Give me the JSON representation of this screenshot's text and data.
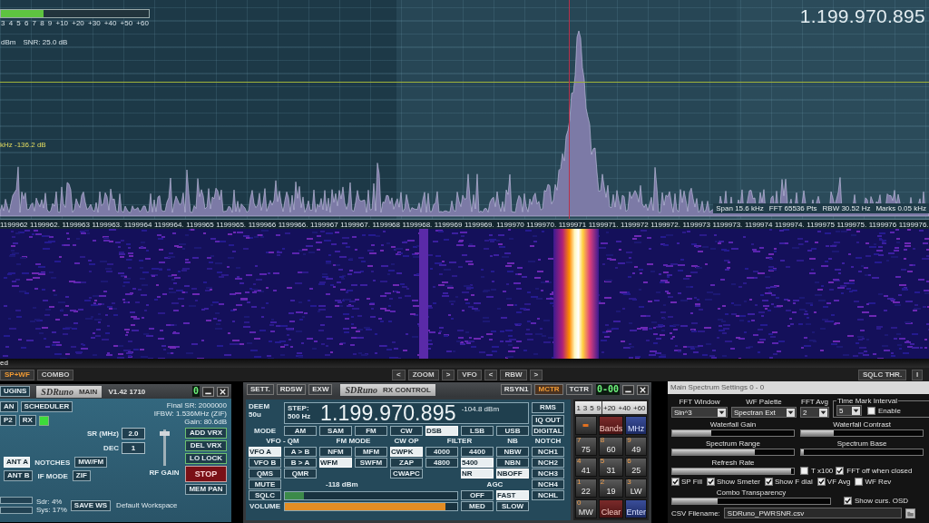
{
  "spectrum": {
    "smeter": {
      "level": 0.29,
      "scale": [
        "3",
        "4",
        "5",
        "6",
        "7",
        "8",
        "9",
        "+10",
        "+20",
        "+30",
        "+40",
        "+50",
        "+60"
      ]
    },
    "readouts": [
      "dBm",
      "SNR: 25.0 dB"
    ],
    "marker_readout": "kHz -136.2 dB",
    "frequency": "1.199.970.895",
    "info": [
      "Span 15.6 kHz",
      "FFT 65536 Pts",
      "RBW 30.52 Hz",
      "Marks 0.05 kHz"
    ],
    "axis_labels": [
      "1199962",
      "1199962.",
      "1199963",
      "1199963.",
      "1199964",
      "1199964.",
      "1199965",
      "1199965.",
      "1199966",
      "1199966.",
      "1199967",
      "1199967.",
      "1199968",
      "1199968.",
      "1199969",
      "1199969.",
      "1199970",
      "1199970.",
      "1199971",
      "1199971.",
      "1199972",
      "1199972.",
      "1199973",
      "1199973.",
      "1199974",
      "1199974.",
      "1199975",
      "1199975.",
      "1199976",
      "1199976."
    ]
  },
  "waterfall": {
    "edge_text": "ed"
  },
  "toolbar": {
    "left": [
      {
        "label": "SP+WF",
        "selected": true
      },
      {
        "label": "COMBO",
        "selected": false
      }
    ],
    "center": [
      "<",
      "ZOOM",
      ">",
      "VFO",
      "<",
      "RBW",
      ">"
    ],
    "right": [
      "SQLC THR.",
      "I"
    ]
  },
  "main_panel": {
    "header": {
      "tab": "UGINS",
      "logo": "SDRuno",
      "title": "MAIN",
      "version": "V1.42 1710",
      "display": "0"
    },
    "top_buttons": [
      [
        {
          "label": "AN",
          "selected": false
        },
        {
          "label": "SCHEDULER",
          "selected": false
        }
      ],
      [
        {
          "label": "P2",
          "selected": false
        },
        {
          "label": "RX",
          "selected": false
        }
      ]
    ],
    "rx_indicator": {
      "on": true
    },
    "info": [
      "Final SR: 2000000",
      "IFBW: 1.536MHz (ZIF)",
      "Gain: 80.6dB"
    ],
    "fields": [
      {
        "label": "SR (MHz)",
        "value": "2.0"
      },
      {
        "label": "DEC",
        "value": "1"
      }
    ],
    "option_rows": [
      {
        "button": {
          "label": "ANT A",
          "selected": true
        },
        "label": "NOTCHES",
        "value": "MW/FM"
      },
      {
        "button": {
          "label": "ANT B",
          "selected": false
        },
        "label": "IF MODE",
        "value": "ZIF"
      }
    ],
    "rf_gain": {
      "label": "RF GAIN",
      "level": 0.95
    },
    "side_buttons": [
      {
        "label": "ADD VRX",
        "kind": "outlined"
      },
      {
        "label": "DEL VRX",
        "kind": "outlined"
      },
      {
        "label": "LO LOCK",
        "kind": "outlined"
      },
      {
        "label": "STOP",
        "kind": "stop"
      },
      {
        "label": "MEM PAN",
        "kind": "plain"
      }
    ],
    "load": [
      "Sdr: 4%",
      "Sys: 17%"
    ],
    "save_button": "SAVE WS",
    "workspace": "Default Workspace"
  },
  "rx_panel": {
    "header": {
      "buttons": [
        {
          "label": "SETT.",
          "selected": false
        },
        {
          "label": "RDSW",
          "selected": false
        },
        {
          "label": "EXW",
          "selected": false
        }
      ],
      "logo": "SDRuno",
      "title": "RX CONTROL",
      "sync_buttons": [
        {
          "label": "RSYN1",
          "selected": false
        },
        {
          "label": "MCTR",
          "selected": true
        },
        {
          "label": "TCTR",
          "selected": false
        }
      ],
      "display": "0-00"
    },
    "deem": "DEEM 50u",
    "display": {
      "step_label": "STEP:",
      "step": "500 Hz",
      "frequency": "1.199.970.895",
      "level": "-104.8 dBm"
    },
    "side": [
      "RMS",
      "IQ OUT"
    ],
    "grid": [
      [
        {
          "kind": "label",
          "text": "MODE"
        },
        {
          "kind": "button",
          "text": "AM",
          "selected": false
        },
        {
          "kind": "button",
          "text": "SAM",
          "selected": false
        },
        {
          "kind": "button",
          "text": "FM",
          "selected": false
        },
        {
          "kind": "button",
          "text": "CW",
          "selected": false
        },
        {
          "kind": "button",
          "text": "DSB",
          "selected": true
        },
        {
          "kind": "button",
          "text": "LSB",
          "selected": false
        },
        {
          "kind": "button",
          "text": "USB",
          "selected": false
        },
        {
          "kind": "button",
          "text": "DIGITAL",
          "selected": false
        }
      ],
      [
        {
          "kind": "wide_heading",
          "text": "VFO - QM"
        },
        {
          "kind": "wide_heading",
          "text": "FM MODE"
        },
        {
          "kind": "heading",
          "text": "CW OP"
        },
        {
          "kind": "wide_heading",
          "text": "FILTER"
        },
        {
          "kind": "heading",
          "text": "NB"
        },
        {
          "kind": "heading",
          "text": "NOTCH"
        }
      ],
      [
        {
          "kind": "button",
          "text": "VFO A",
          "selected": true
        },
        {
          "kind": "button",
          "text": "A > B",
          "selected": false
        },
        {
          "kind": "button",
          "text": "NFM",
          "selected": false
        },
        {
          "kind": "button",
          "text": "MFM",
          "selected": false
        },
        {
          "kind": "button",
          "text": "CWPK",
          "selected": true
        },
        {
          "kind": "button",
          "text": "4000",
          "selected": false
        },
        {
          "kind": "button",
          "text": "4400",
          "selected": false
        },
        {
          "kind": "button",
          "text": "NBW",
          "selected": false
        },
        {
          "kind": "button",
          "text": "NCH1",
          "selected": false
        }
      ],
      [
        {
          "kind": "button",
          "text": "VFO B",
          "selected": false
        },
        {
          "kind": "button",
          "text": "B > A",
          "selected": false
        },
        {
          "kind": "button",
          "text": "WFM",
          "selected": true
        },
        {
          "kind": "button",
          "text": "SWFM",
          "selected": false
        },
        {
          "kind": "button",
          "text": "ZAP",
          "selected": false
        },
        {
          "kind": "button",
          "text": "4800",
          "selected": false
        },
        {
          "kind": "button",
          "text": "5400",
          "selected": true
        },
        {
          "kind": "button",
          "text": "NBN",
          "selected": false
        },
        {
          "kind": "button",
          "text": "NCH2",
          "selected": false
        }
      ],
      [
        {
          "kind": "button",
          "text": "QMS",
          "selected": false
        },
        {
          "kind": "button",
          "text": "QMR",
          "selected": false
        },
        {
          "kind": "gap"
        },
        {
          "kind": "gap"
        },
        {
          "kind": "button",
          "text": "CWAPC",
          "selected": false
        },
        {
          "kind": "gap"
        },
        {
          "kind": "button",
          "text": "NR",
          "selected": true
        },
        {
          "kind": "button",
          "text": "NBOFF",
          "selected": true
        },
        {
          "kind": "button",
          "text": "NCH3",
          "selected": false
        }
      ],
      [
        {
          "kind": "button",
          "text": "MUTE",
          "selected": false
        },
        {
          "kind": "bar_caption",
          "text": "-118 dBm"
        },
        {
          "kind": "wide_heading",
          "text": "AGC"
        },
        {
          "kind": "button",
          "text": "NCH4",
          "selected": false
        }
      ],
      [
        {
          "kind": "button",
          "text": "SQLC",
          "selected": false
        },
        {
          "kind": "signal_bar",
          "level": 0.11
        },
        {
          "kind": "button",
          "text": "OFF",
          "selected": false
        },
        {
          "kind": "button",
          "text": "FAST",
          "selected": true
        },
        {
          "kind": "button",
          "text": "NCHL",
          "selected": false
        }
      ],
      [
        {
          "kind": "label",
          "text": "VOLUME"
        },
        {
          "kind": "volume_bar",
          "level": 0.93
        },
        {
          "kind": "button",
          "text": "MED",
          "selected": false
        },
        {
          "kind": "button",
          "text": "SLOW",
          "selected": false
        }
      ]
    ],
    "keypad": {
      "meter_scale": [
        "1",
        "3",
        "5",
        "9",
        "+20",
        "+40",
        "+60"
      ],
      "keys": [
        {
          "kind": "marker"
        },
        {
          "kind": "warm",
          "label": "Bands"
        },
        {
          "kind": "cool",
          "label": "MHz"
        },
        {
          "kind": "plain",
          "label": "75",
          "digit": "7"
        },
        {
          "kind": "plain",
          "label": "60",
          "digit": "8"
        },
        {
          "kind": "plain",
          "label": "49",
          "digit": "9"
        },
        {
          "kind": "plain",
          "label": "41",
          "digit": "4"
        },
        {
          "kind": "plain",
          "label": "31",
          "digit": "5"
        },
        {
          "kind": "plain",
          "label": "25",
          "digit": "6"
        },
        {
          "kind": "plain",
          "label": "22",
          "digit": "1"
        },
        {
          "kind": "plain",
          "label": "19",
          "digit": "2"
        },
        {
          "kind": "plain",
          "label": "LW",
          "digit": "3"
        },
        {
          "kind": "plain",
          "label": "MW",
          "digit": "0"
        },
        {
          "kind": "warm",
          "label": "Clear"
        },
        {
          "kind": "cool",
          "label": "Enter"
        }
      ]
    }
  },
  "settings": {
    "title": "Main Spectrum Settings 0 - 0",
    "selects": [
      {
        "label": "FFT Window",
        "value": "Sin^3"
      },
      {
        "label": "WF Palette",
        "value": "Spectran Ext"
      },
      {
        "label": "FFT Avg",
        "value": "2"
      }
    ],
    "time_mark": {
      "label": "Time Mark Interval",
      "value": "5",
      "enable": {
        "label": "Enable",
        "checked": false
      }
    },
    "slider_pairs": [
      [
        {
          "label": "Waterfall Gain",
          "level": 0.32
        },
        {
          "label": "Waterfall Contrast",
          "level": 0.27
        }
      ],
      [
        {
          "label": "Spectrum Range",
          "level": 0.68
        },
        {
          "label": "Spectrum Base",
          "level": 0.02
        }
      ]
    ],
    "refresh": {
      "label": "Refresh Rate",
      "level": 0.98,
      "options": [
        {
          "label": "T x100",
          "checked": false
        },
        {
          "label": "FFT off when closed",
          "checked": true
        }
      ]
    },
    "checkboxes": [
      {
        "label": "SP Fill",
        "checked": true
      },
      {
        "label": "Show Smeter",
        "checked": true
      },
      {
        "label": "Show F dial",
        "checked": true
      },
      {
        "label": "VF Avg",
        "checked": true
      },
      {
        "label": "WF Rev",
        "checked": false
      }
    ],
    "combo": {
      "label": "Combo Transparency",
      "level": 0.29,
      "option": {
        "label": "Show curs. OSD",
        "checked": true
      }
    },
    "csv": {
      "label": "CSV Filename:",
      "value": "SDRuno_PWRSNR.csv"
    }
  }
}
